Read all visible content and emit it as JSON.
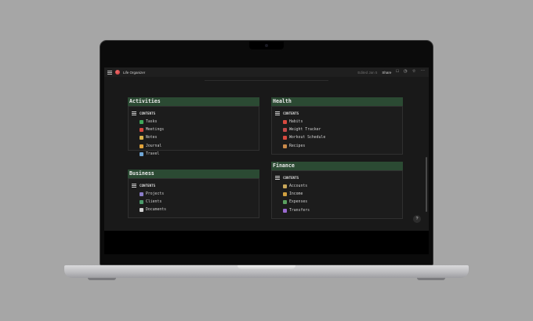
{
  "app": {
    "title": "Life Organizer",
    "edited": "Edited Jan 5",
    "share_label": "Share"
  },
  "icons": {
    "menu": "hamburger-icon",
    "page": "red-circle-page-icon",
    "comment": "comment-icon",
    "history": "clock-icon",
    "favorite": "star-icon",
    "more": "more-icon",
    "help": "help-icon"
  },
  "colors": {
    "header_bg": "#2b4a33",
    "screen_bg": "#191919"
  },
  "sections": {
    "activities": {
      "title": "Activities",
      "contents_label": "CONTENTS",
      "items": [
        {
          "label": "Tasks",
          "icon": "check-icon",
          "color": "#3fa85a"
        },
        {
          "label": "Meetings",
          "icon": "calendar-icon",
          "color": "#d8493f"
        },
        {
          "label": "Notes",
          "icon": "pencil-icon",
          "color": "#d9b24a"
        },
        {
          "label": "Journal",
          "icon": "notebook-icon",
          "color": "#e0a23a"
        },
        {
          "label": "Travel",
          "icon": "airplane-icon",
          "color": "#6fa6d6"
        }
      ]
    },
    "business": {
      "title": "Business",
      "contents_label": "CONTENTS",
      "items": [
        {
          "label": "Projects",
          "icon": "palette-icon",
          "color": "#8a7cc8"
        },
        {
          "label": "Clients",
          "icon": "people-icon",
          "color": "#4a9a6a"
        },
        {
          "label": "Documents",
          "icon": "document-icon",
          "color": "#cfcfcf"
        }
      ]
    },
    "health": {
      "title": "Health",
      "contents_label": "CONTENTS",
      "items": [
        {
          "label": "Habits",
          "icon": "target-icon",
          "color": "#d8493f"
        },
        {
          "label": "Weight Tracker",
          "icon": "scale-icon",
          "color": "#c24a4a"
        },
        {
          "label": "Workout Schedule",
          "icon": "calendar-icon",
          "color": "#d8493f"
        },
        {
          "label": "Recipes",
          "icon": "food-icon",
          "color": "#c98a4a"
        }
      ]
    },
    "finance": {
      "title": "Finance",
      "contents_label": "CONTENTS",
      "items": [
        {
          "label": "Accounts",
          "icon": "bank-icon",
          "color": "#c9a75a"
        },
        {
          "label": "Income",
          "icon": "moneybag-icon",
          "color": "#d0a040"
        },
        {
          "label": "Expenses",
          "icon": "money-icon",
          "color": "#5aa060"
        },
        {
          "label": "Transfers",
          "icon": "transfer-icon",
          "color": "#9a6ad0"
        }
      ]
    }
  },
  "help_label": "?"
}
